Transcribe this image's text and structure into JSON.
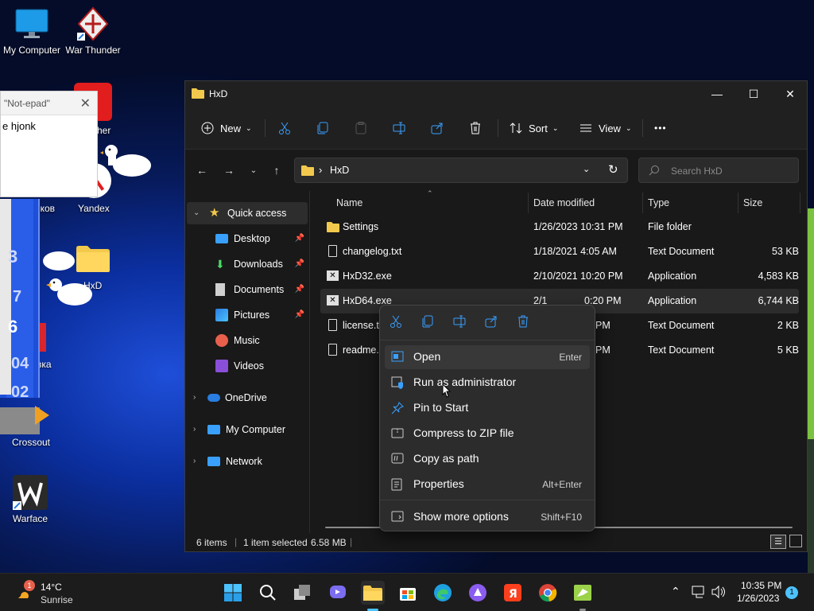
{
  "desktop": {
    "icons": [
      {
        "label": "My Computer"
      },
      {
        "label": "War Thunder"
      },
      {
        "label": "cher"
      },
      {
        "label": "нков"
      },
      {
        "label": "Yandex"
      },
      {
        "label": "HxD"
      },
      {
        "label": "вка"
      },
      {
        "label": "Crossout"
      },
      {
        "label": "Warface"
      }
    ],
    "side_digits": [
      "3",
      "7",
      "6",
      "04",
      "02"
    ]
  },
  "notepad": {
    "tab_title": "\"Not-epad\"",
    "close_glyph": "✕",
    "text": "e hjonk"
  },
  "explorer": {
    "title": "HxD",
    "window_buttons": {
      "minimize": "—",
      "maximize": "☐",
      "close": "✕"
    },
    "toolbar": {
      "new_label": "New",
      "sort_label": "Sort",
      "view_label": "View",
      "more": "•••"
    },
    "address": {
      "chevron": "›",
      "path": "HxD"
    },
    "search": {
      "placeholder": "Search HxD"
    },
    "nav": {
      "quick_access": "Quick access",
      "pinned": [
        {
          "label": "Desktop"
        },
        {
          "label": "Downloads"
        },
        {
          "label": "Documents"
        },
        {
          "label": "Pictures"
        },
        {
          "label": "Music"
        },
        {
          "label": "Videos"
        }
      ],
      "onedrive": "OneDrive",
      "my_computer": "My Computer",
      "network": "Network"
    },
    "columns": {
      "name": "Name",
      "date": "Date modified",
      "type": "Type",
      "size": "Size"
    },
    "files": [
      {
        "name": "Settings",
        "date": "1/26/2023 10:31 PM",
        "type": "File folder",
        "size": ""
      },
      {
        "name": "changelog.txt",
        "date": "1/18/2021 4:05 AM",
        "type": "Text Document",
        "size": "53 KB"
      },
      {
        "name": "HxD32.exe",
        "date": "2/10/2021 10:20 PM",
        "type": "Application",
        "size": "4,583 KB"
      },
      {
        "name": "HxD64.exe",
        "date": "2/1",
        "date_tail": "0:20 PM",
        "type": "Application",
        "size": "6,744 KB"
      },
      {
        "name": "license.tx",
        "date": "PM",
        "type": "Text Document",
        "size": "2 KB"
      },
      {
        "name": "readme.t",
        "date": "PM",
        "type": "Text Document",
        "size": "5 KB"
      }
    ],
    "status": {
      "items": "6 items",
      "selected": "1 item selected",
      "size": "6.58 MB"
    }
  },
  "context_menu": {
    "items": [
      {
        "label": "Open",
        "shortcut": "Enter"
      },
      {
        "label": "Run as administrator",
        "shortcut": ""
      },
      {
        "label": "Pin to Start",
        "shortcut": ""
      },
      {
        "label": "Compress to ZIP file",
        "shortcut": ""
      },
      {
        "label": "Copy as path",
        "shortcut": ""
      },
      {
        "label": "Properties",
        "shortcut": "Alt+Enter"
      },
      {
        "label": "Show more options",
        "shortcut": "Shift+F10"
      }
    ]
  },
  "taskbar": {
    "weather": {
      "temp": "14°C",
      "condition": "Sunrise",
      "badge": "1"
    },
    "time": "10:35 PM",
    "date": "1/26/2023",
    "notification_count": "1"
  },
  "colors": {
    "accent": "#4cc2ff",
    "folder": "#f2c94c",
    "selection": "#2c2c2c"
  }
}
